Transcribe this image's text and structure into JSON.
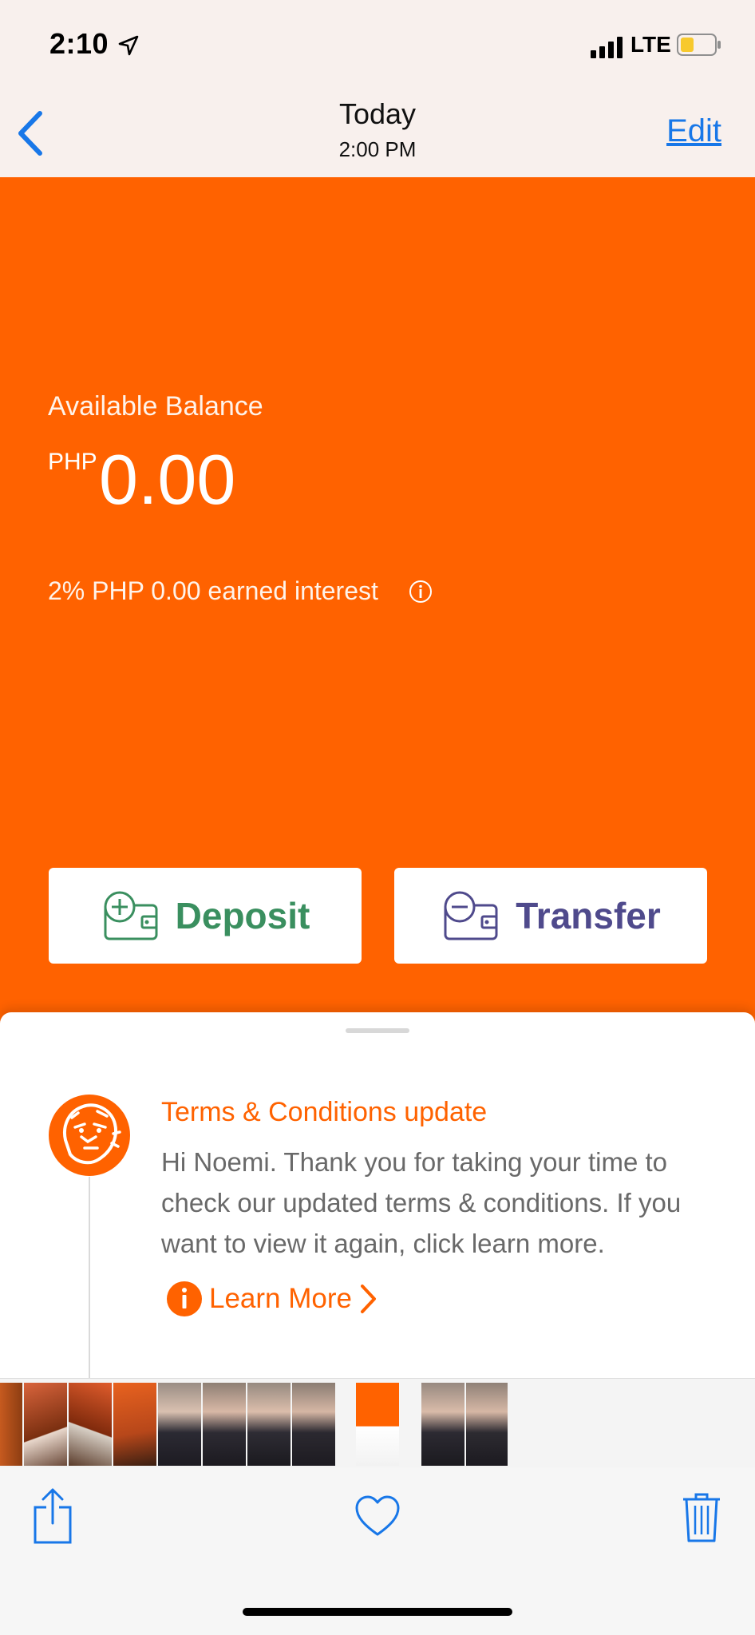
{
  "status_bar": {
    "time": "2:10",
    "network": "LTE"
  },
  "nav": {
    "title": "Today",
    "subtitle": "2:00 PM",
    "edit_label": "Edit"
  },
  "balance": {
    "label": "Available Balance",
    "currency": "PHP",
    "amount": "0.00",
    "interest_text": "2% PHP 0.00 earned interest"
  },
  "actions": {
    "deposit_label": "Deposit",
    "transfer_label": "Transfer"
  },
  "message": {
    "title": "Terms & Conditions update",
    "body": "Hi Noemi. Thank you for taking your time to check our updated terms & conditions. If you want to view it again, click learn more.",
    "link_label": "Learn More"
  },
  "colors": {
    "brand_orange": "#ff6200",
    "deposit_green": "#3a8f5f",
    "transfer_purple": "#4f4a8c",
    "ios_blue": "#1877e8"
  },
  "icons": [
    "location-arrow-icon",
    "signal-icon",
    "battery-icon",
    "back-chevron-icon",
    "info-icon",
    "wallet-plus-icon",
    "wallet-minus-icon",
    "lion-logo-icon",
    "share-icon",
    "heart-icon",
    "trash-icon"
  ]
}
